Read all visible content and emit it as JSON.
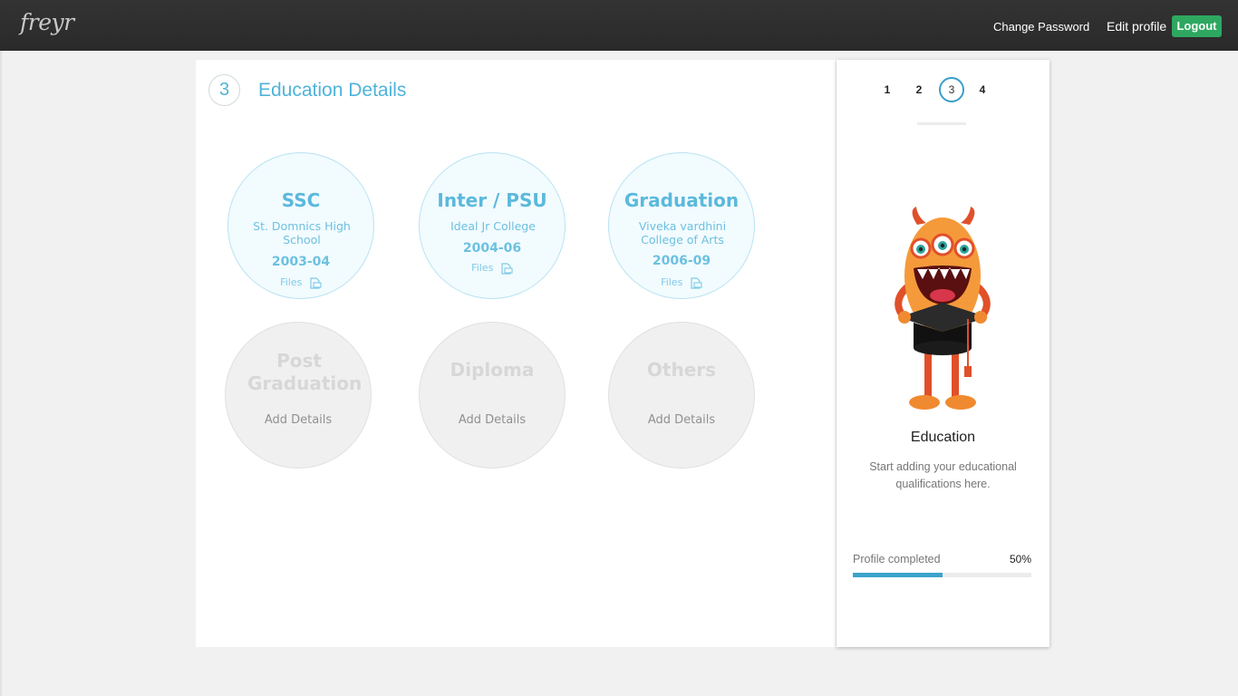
{
  "header": {
    "logo": "freyr",
    "change_password": "Change Password",
    "edit_profile": "Edit profile",
    "logout": "Logout"
  },
  "section": {
    "step": "3",
    "title": "Education Details"
  },
  "education": {
    "ssc": {
      "title": "SSC",
      "school": "St. Domnics High School",
      "years": "2003-04",
      "files": "Files"
    },
    "inter": {
      "title": "Inter / PSU",
      "school": "Ideal Jr College",
      "years": "2004-06",
      "files": "Files"
    },
    "graduation": {
      "title": "Graduation",
      "school": "Viveka vardhini College of Arts",
      "years": "2006-09",
      "files": "Files"
    },
    "post_graduation": {
      "title": "Post Graduation",
      "action": "Add Details"
    },
    "diploma": {
      "title": "Diploma",
      "action": "Add Details"
    },
    "others": {
      "title": "Others",
      "action": "Add Details"
    }
  },
  "sidebar": {
    "steps": [
      "1",
      "2",
      "3",
      "4"
    ],
    "active_step": "3",
    "heading": "Education",
    "description": "Start adding your educational qualifications here.",
    "progress_label": "Profile completed",
    "progress_value": "50%",
    "progress_fraction": 0.5
  },
  "colors": {
    "accent": "#4fb3d9",
    "logout": "#2ea860",
    "progress": "#3aa3cc"
  }
}
